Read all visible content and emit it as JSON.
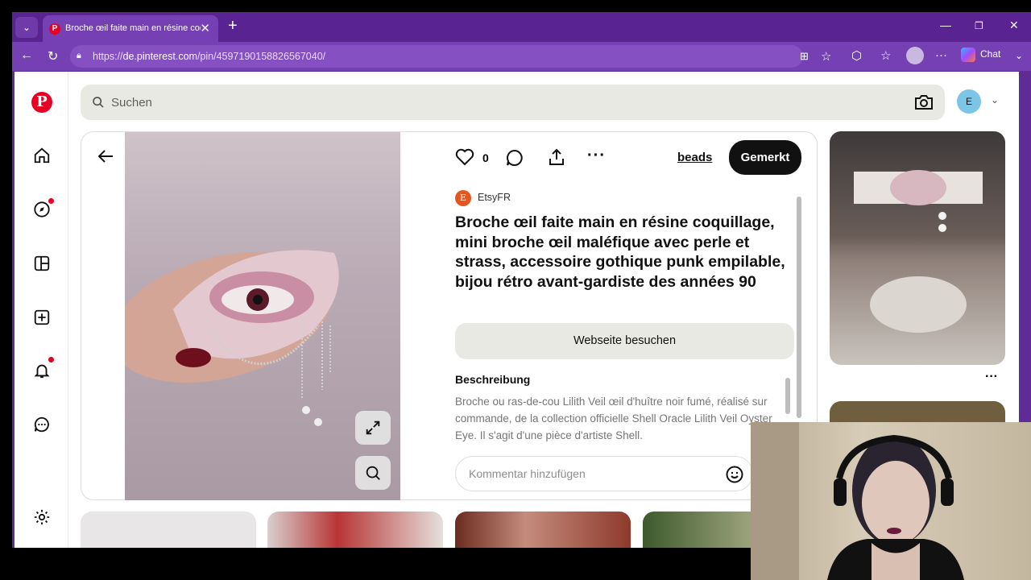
{
  "tab": {
    "title": "Broche œil faite main en résine coquillage",
    "close": "✕",
    "new": "+"
  },
  "address": {
    "url_prefix": "https://",
    "url_host": "de.pinterest.com",
    "url_path": "/pin/4597190158826567040/"
  },
  "toolbar": {
    "chat_label": "Chat"
  },
  "search": {
    "placeholder": "Suchen"
  },
  "user": {
    "initial": "E"
  },
  "pin": {
    "likes": "0",
    "board": "beads",
    "save_label": "Gemerkt",
    "source": "EtsyFR",
    "source_initial": "E",
    "title": "Broche œil faite main en résine coquillage, mini broche œil maléfique avec perle et strass, accessoire gothique punk empilable, bijou rétro avant-gardiste des années 90",
    "visit_label": "Webseite besuchen",
    "description_heading": "Beschreibung",
    "description": "Broche ou ras-de-cou Lilith Veil œil d'huître noir fumé, réalisé sur commande, de la collection officielle Shell Oracle Lilith Veil Oyster Eye. Il s'agit d'une pièce d'artiste Shell.",
    "comment_placeholder": "Kommentar hinzufügen"
  },
  "more": "···",
  "colors": {
    "brand": "#e60023",
    "browser": "#5e2b97"
  },
  "icons": [
    "pinterest-logo-icon",
    "home-icon",
    "explore-icon",
    "boards-icon",
    "create-icon",
    "notifications-icon",
    "messages-icon",
    "settings-icon",
    "camera-search-icon",
    "back-arrow-icon",
    "heart-icon",
    "comment-icon",
    "share-icon",
    "more-icon",
    "expand-icon",
    "visual-search-icon",
    "emoji-icon"
  ]
}
